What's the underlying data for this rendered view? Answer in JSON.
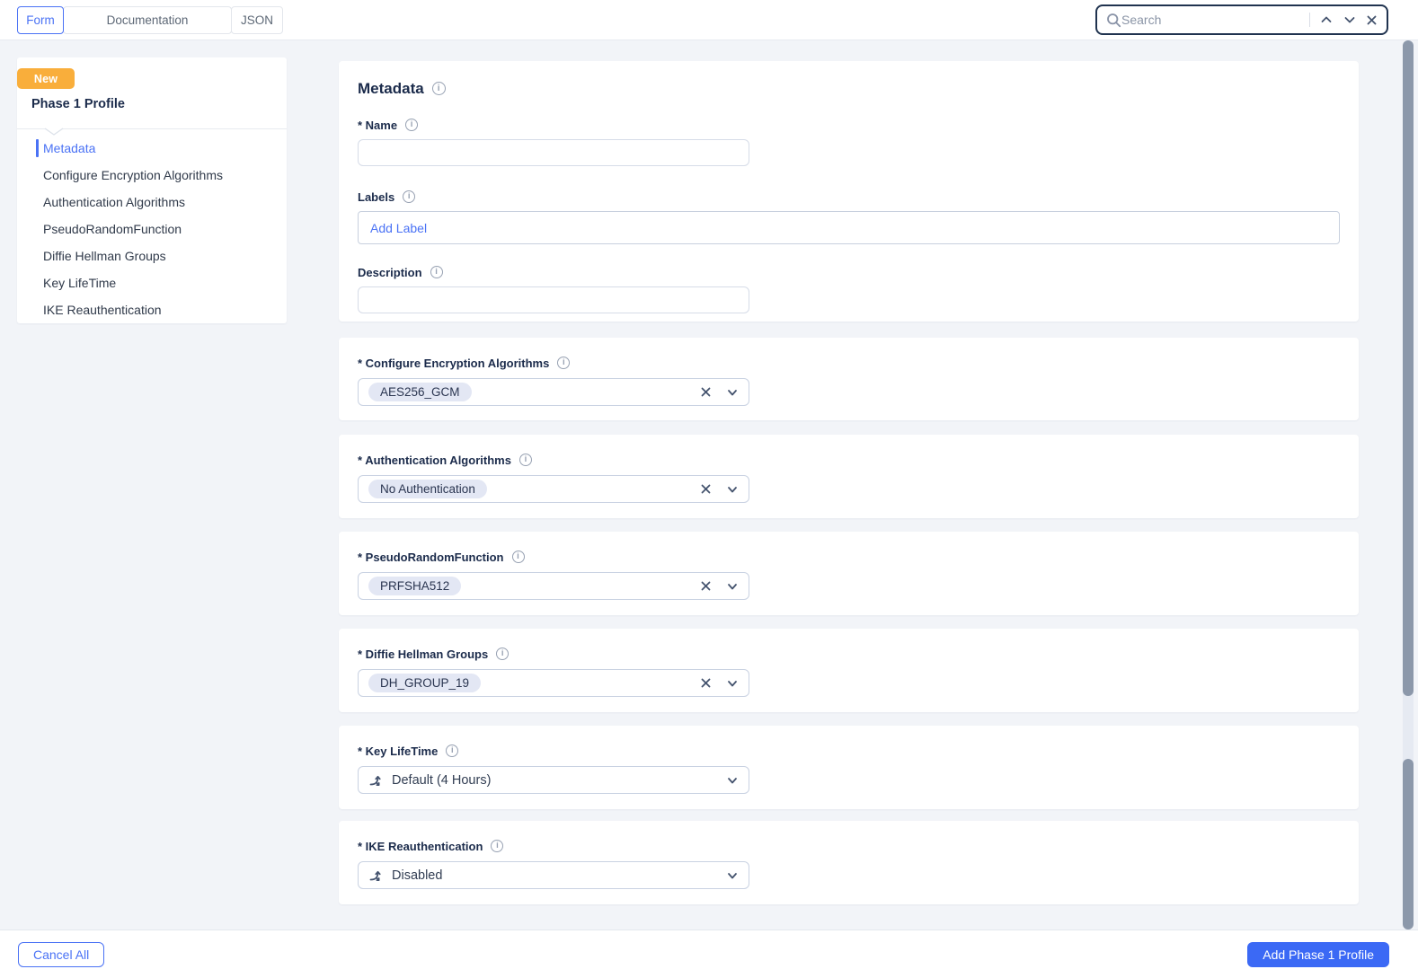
{
  "header": {
    "tabs": [
      {
        "label": "Form",
        "active": true
      },
      {
        "label": "Documentation",
        "active": false
      },
      {
        "label": "JSON",
        "active": false
      }
    ],
    "search": {
      "placeholder": "Search"
    }
  },
  "sidebar": {
    "badge": "New",
    "title": "Phase 1 Profile",
    "items": [
      {
        "label": "Metadata",
        "active": true
      },
      {
        "label": "Configure Encryption Algorithms",
        "active": false
      },
      {
        "label": "Authentication Algorithms",
        "active": false
      },
      {
        "label": "PseudoRandomFunction",
        "active": false
      },
      {
        "label": "Diffie Hellman Groups",
        "active": false
      },
      {
        "label": "Key LifeTime",
        "active": false
      },
      {
        "label": "IKE Reauthentication",
        "active": false
      }
    ]
  },
  "form": {
    "metadata": {
      "title": "Metadata",
      "name_label": "* Name",
      "name_value": "",
      "labels_label": "Labels",
      "add_label_text": "Add Label",
      "description_label": "Description",
      "description_value": ""
    },
    "chip_sections": [
      {
        "label": "* Configure Encryption Algorithms",
        "value": "AES256_GCM"
      },
      {
        "label": "* Authentication Algorithms",
        "value": "No Authentication"
      },
      {
        "label": "* PseudoRandomFunction",
        "value": "PRFSHA512"
      },
      {
        "label": "* Diffie Hellman Groups",
        "value": "DH_GROUP_19"
      }
    ],
    "dropdown_sections": [
      {
        "label": "* Key LifeTime",
        "value": "Default (4 Hours)"
      },
      {
        "label": "* IKE Reauthentication",
        "value": "Disabled"
      }
    ]
  },
  "footer": {
    "cancel_label": "Cancel All",
    "submit_label": "Add Phase 1 Profile"
  },
  "colors": {
    "accent_blue": "#4A72F5",
    "primary_button": "#3B69F5",
    "badge_orange": "#F9AE3B",
    "navy_text": "#1B2B4B",
    "chip_bg": "#E3E7F4",
    "search_border": "#20334F",
    "scrollbar_thumb": "#8C98AA"
  }
}
